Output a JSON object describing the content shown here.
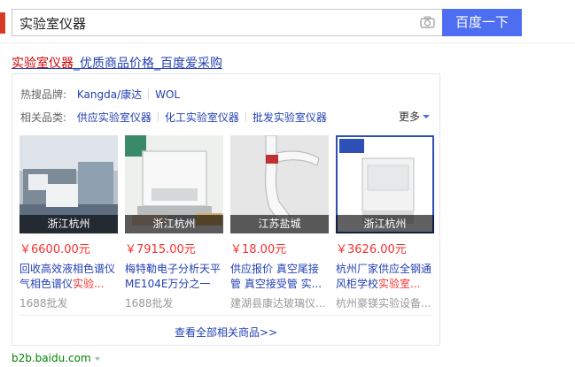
{
  "search": {
    "query": "实验室仪器",
    "button_label": "百度一下"
  },
  "result": {
    "title_highlight": "实验室仪器",
    "title_rest": "_优质商品价格_百度爱采购",
    "hot_brands_label": "热搜品牌:",
    "hot_brands": [
      "Kangda/康达",
      "WOL"
    ],
    "related_label": "相关品类:",
    "related": [
      "供应实验室仪器",
      "化工实验室仪器",
      "批发实验室仪器"
    ],
    "more_label": "更多",
    "products": [
      {
        "location": "浙江杭州",
        "price": "￥6600.00元",
        "desc": "回收高效液相色谱仪气相色谱仪",
        "desc_highlight": "实验...",
        "source": "1688批发"
      },
      {
        "location": "浙江杭州",
        "price": "￥7915.00元",
        "desc": "梅特勒电子分析天平ME104E万分之一",
        "desc_highlight": "",
        "source": "1688批发"
      },
      {
        "location": "江苏盐城",
        "price": "￥18.00元",
        "desc": "供应报价 真空尾接管 真空接受管 实...",
        "desc_highlight": "",
        "source": "建湖县康达玻璃仪..."
      },
      {
        "location": "浙江杭州",
        "price": "￥3626.00元",
        "desc": "杭州厂家供应全钢通风柜学校",
        "desc_highlight": "实验室...",
        "source": "杭州豪镁实验设备..."
      }
    ],
    "view_all_label": "查看全部相关商品>>",
    "url": "b2b.baidu.com"
  },
  "colors": {
    "link": "#2440b3",
    "highlight": "#c00",
    "price": "#f73131",
    "button": "#4e6ef2",
    "url": "#008000"
  }
}
